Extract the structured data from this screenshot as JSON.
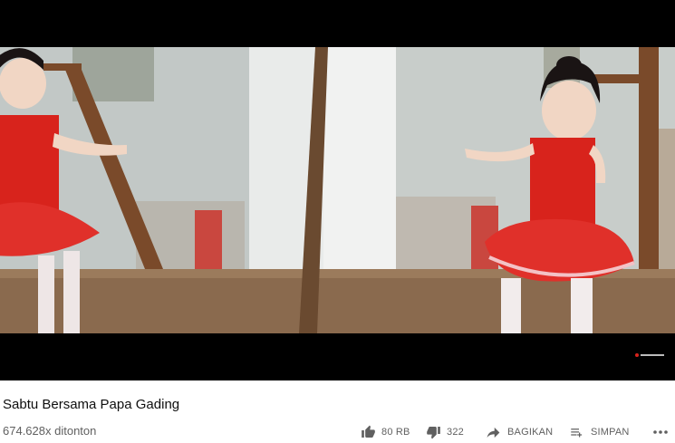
{
  "video": {
    "title": "Sabtu Bersama Papa Gading",
    "views": "674.628x ditonton",
    "thumbnail_subject": "little girl in red ballet dress dancing in front of mirror"
  },
  "actions": {
    "like": {
      "icon": "thumb-up-icon",
      "label": "80 RB"
    },
    "dislike": {
      "icon": "thumb-down-icon",
      "label": "322"
    },
    "share": {
      "icon": "share-arrow-icon",
      "label": "BAGIKAN"
    },
    "save": {
      "icon": "playlist-add-icon",
      "label": "SIMPAN"
    },
    "more": {
      "icon": "more-horizontal-icon",
      "label": "..."
    }
  },
  "colors": {
    "text_primary": "#0f0f0f",
    "text_secondary": "#606060",
    "letterbox": "#000000",
    "dress_red": "#d8231c"
  }
}
